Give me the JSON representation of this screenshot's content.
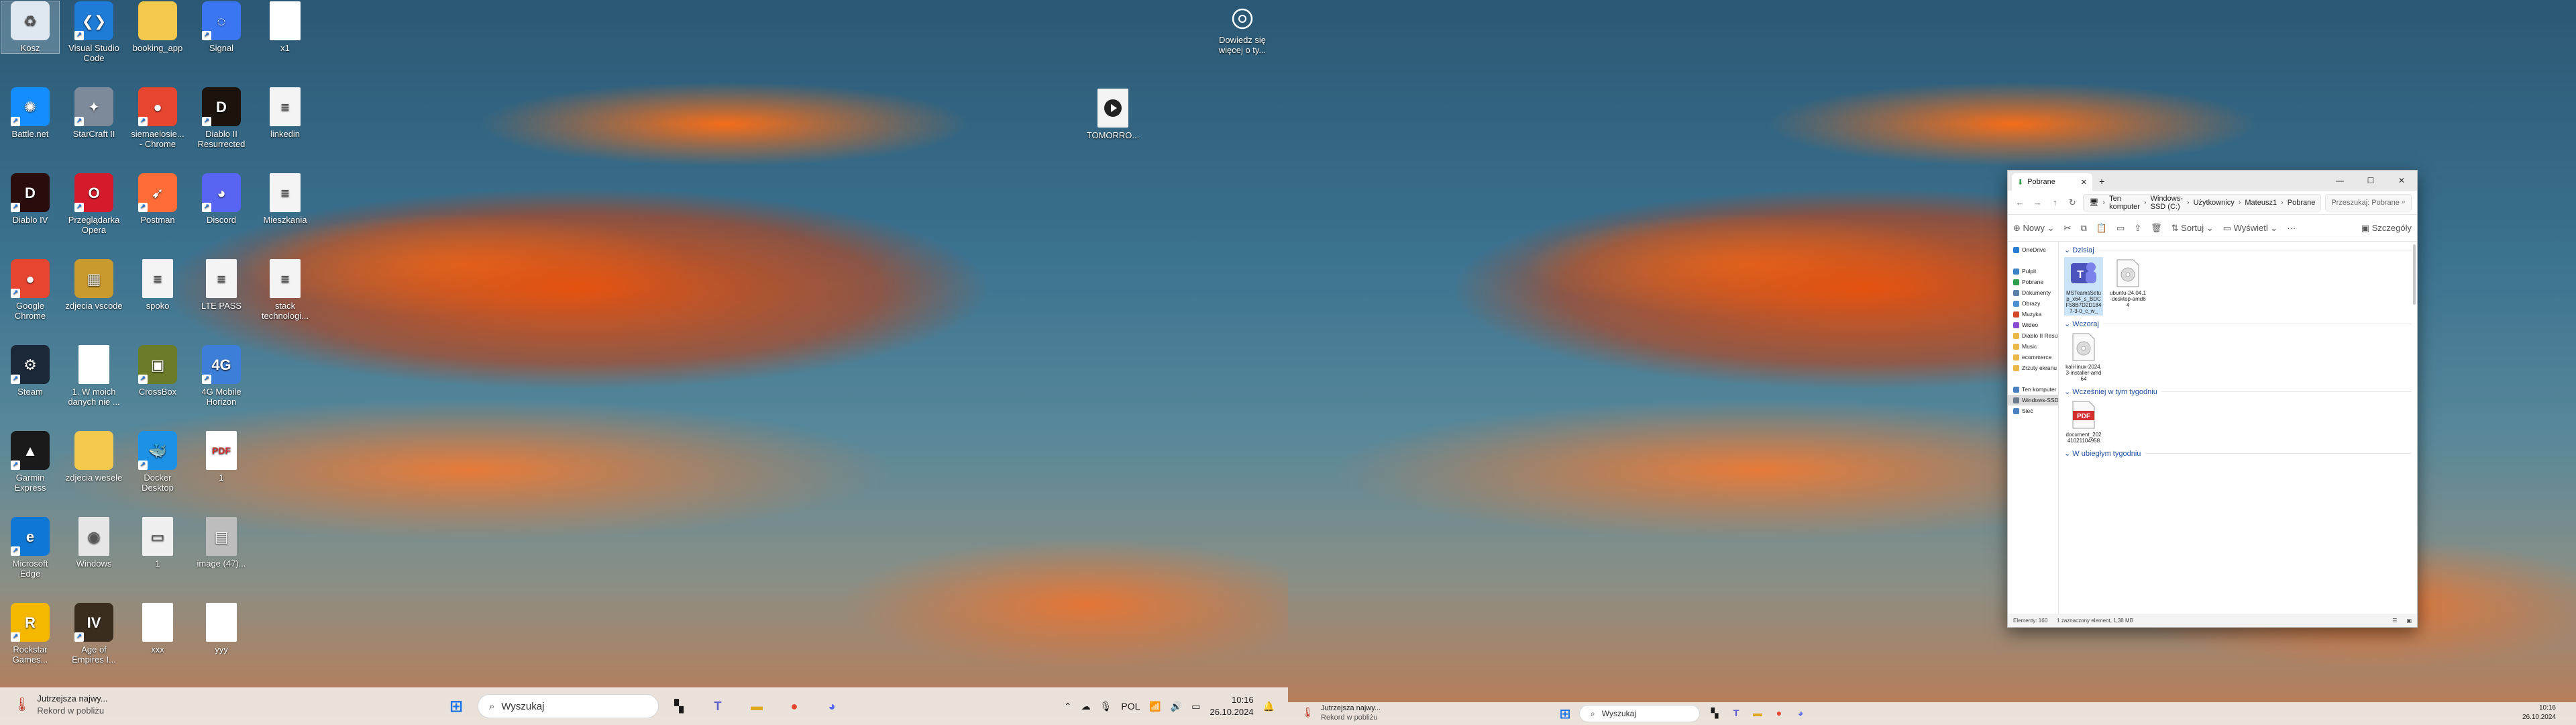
{
  "desktop_icons": [
    {
      "label": "Kosz",
      "icon": "recycle-bin-icon",
      "color": "#dfe8f0",
      "glyph": "♻"
    },
    {
      "label": "Visual Studio Code",
      "icon": "vscode-icon",
      "color": "#1e7bd6",
      "glyph": "❮❯"
    },
    {
      "label": "booking_app",
      "icon": "folder-icon",
      "color": "#f2c94c",
      "glyph": ""
    },
    {
      "label": "Signal",
      "icon": "signal-icon",
      "color": "#3a76f0",
      "glyph": "◌"
    },
    {
      "label": "x1",
      "icon": "document-icon",
      "color": "#ffffff",
      "glyph": ""
    },
    {
      "label": "Battle.net",
      "icon": "battlenet-icon",
      "color": "#148eff",
      "glyph": "✺"
    },
    {
      "label": "StarCraft II",
      "icon": "starcraft-icon",
      "color": "#7d8a99",
      "glyph": "✦"
    },
    {
      "label": "siemaelosie... - Chrome",
      "icon": "chrome-icon",
      "color": "#e6452f",
      "glyph": "●"
    },
    {
      "label": "Diablo II Resurrected",
      "icon": "diablo2-icon",
      "color": "#1a120b",
      "glyph": "D"
    },
    {
      "label": "linkedin",
      "icon": "document-icon",
      "color": "#f4f4f4",
      "glyph": "≡"
    },
    {
      "label": "Diablo IV",
      "icon": "diablo4-icon",
      "color": "#2a0c0c",
      "glyph": "D"
    },
    {
      "label": "Przeglądarka Opera",
      "icon": "opera-icon",
      "color": "#d51a2b",
      "glyph": "O"
    },
    {
      "label": "Postman",
      "icon": "postman-icon",
      "color": "#ff6c37",
      "glyph": "➹"
    },
    {
      "label": "Discord",
      "icon": "discord-icon",
      "color": "#5865f2",
      "glyph": "◕"
    },
    {
      "label": "Mieszkania",
      "icon": "document-icon",
      "color": "#f4f4f4",
      "glyph": "≡"
    },
    {
      "label": "Google Chrome",
      "icon": "chrome-icon",
      "color": "#e6452f",
      "glyph": "●"
    },
    {
      "label": "zdjecia vscode",
      "icon": "folder-image-icon",
      "color": "#c99a2e",
      "glyph": "▦"
    },
    {
      "label": "spoko",
      "icon": "document-icon",
      "color": "#f4f4f4",
      "glyph": "≡"
    },
    {
      "label": "LTE PASS",
      "icon": "document-icon",
      "color": "#f4f4f4",
      "glyph": "≡"
    },
    {
      "label": "stack technologi...",
      "icon": "document-icon",
      "color": "#f4f4f4",
      "glyph": "≡"
    },
    {
      "label": "Steam",
      "icon": "steam-icon",
      "color": "#1b2838",
      "glyph": "⚙"
    },
    {
      "label": "1. W moich danych nie ...",
      "icon": "document-icon",
      "color": "#ffffff",
      "glyph": ""
    },
    {
      "label": "CrossBox",
      "icon": "crossbox-icon",
      "color": "#6a7c2a",
      "glyph": "▣"
    },
    {
      "label": "4G Mobile Horizon",
      "icon": "mobile-horizon-icon",
      "color": "#3d7fd8",
      "glyph": "4G"
    },
    {
      "label": "",
      "icon": "empty-icon",
      "color": "transparent",
      "glyph": ""
    },
    {
      "label": "Garmin Express",
      "icon": "garmin-icon",
      "color": "#1a1a1a",
      "glyph": "▲"
    },
    {
      "label": "zdjecia wesele",
      "icon": "folder-icon",
      "color": "#f2c94c",
      "glyph": ""
    },
    {
      "label": "Docker Desktop",
      "icon": "docker-icon",
      "color": "#1d91e6",
      "glyph": "🐳"
    },
    {
      "label": "1",
      "icon": "pdf-icon",
      "color": "#ffffff",
      "glyph": "PDF"
    },
    {
      "label": "",
      "icon": "empty-icon",
      "color": "transparent",
      "glyph": ""
    },
    {
      "label": "Microsoft Edge",
      "icon": "edge-icon",
      "color": "#0f78d4",
      "glyph": "e"
    },
    {
      "label": "Windows",
      "icon": "iso-icon",
      "color": "#e6e6e6",
      "glyph": "◉"
    },
    {
      "label": "1",
      "icon": "image-icon",
      "color": "#f0f0f0",
      "glyph": "▭"
    },
    {
      "label": "image (47)...",
      "icon": "image-icon",
      "color": "#bdbdbd",
      "glyph": "▤"
    },
    {
      "label": "",
      "icon": "empty-icon",
      "color": "transparent",
      "glyph": ""
    },
    {
      "label": "Rockstar Games...",
      "icon": "rockstar-icon",
      "color": "#f5b700",
      "glyph": "R"
    },
    {
      "label": "Age of Empires I...",
      "icon": "aoe-icon",
      "color": "#3a2d1f",
      "glyph": "IV"
    },
    {
      "label": "xxx",
      "icon": "document-icon",
      "color": "#ffffff",
      "glyph": ""
    },
    {
      "label": "yyy",
      "icon": "document-icon",
      "color": "#ffffff",
      "glyph": ""
    },
    {
      "label": "",
      "icon": "empty-icon",
      "color": "transparent",
      "glyph": ""
    }
  ],
  "right_top_widget": {
    "label": "Dowiedz się więcej o ty..."
  },
  "tomorrow_icon": {
    "label": "TOMORRO..."
  },
  "taskbar_left": {
    "news_title": "Jutrzejsza najwy...",
    "news_sub": "Rekord w pobliżu",
    "search_placeholder": "Wyszukaj",
    "lang": "POL",
    "time": "10:16",
    "date": "26.10.2024"
  },
  "taskbar_right": {
    "news_title": "Jutrzejsza najwy...",
    "news_sub": "Rekord w pobliżu",
    "search_placeholder": "Wyszukaj",
    "time": "10:16",
    "date": "26.10.2024"
  },
  "explorer": {
    "tab_title": "Pobrane",
    "breadcrumbs": [
      "Ten komputer",
      "Windows-SSD (C:)",
      "Użytkownicy",
      "Mateusz1",
      "Pobrane"
    ],
    "search_placeholder": "Przeszukaj: Pobrane",
    "cmd": {
      "new": "Nowy",
      "sort": "Sortuj",
      "view": "Wyświetl",
      "details": "Szczegóły"
    },
    "nav": [
      {
        "label": "OneDrive",
        "color": "#2b7cd3"
      },
      {
        "label": "",
        "color": "transparent"
      },
      {
        "label": "Pulpit",
        "color": "#3b82c4"
      },
      {
        "label": "Pobrane",
        "color": "#2d9f4a"
      },
      {
        "label": "Dokumenty",
        "color": "#5a7fa8"
      },
      {
        "label": "Obrazy",
        "color": "#4b8fd1"
      },
      {
        "label": "Muzyka",
        "color": "#d2492a"
      },
      {
        "label": "Wideo",
        "color": "#8a4bd1"
      },
      {
        "label": "Diablo II Resurre",
        "color": "#e8b84a"
      },
      {
        "label": "Music",
        "color": "#e8b84a"
      },
      {
        "label": "ecommerce",
        "color": "#e8b84a"
      },
      {
        "label": "Zrzuty ekranu",
        "color": "#e8b84a"
      },
      {
        "label": "",
        "color": "transparent"
      },
      {
        "label": "Ten komputer",
        "color": "#4a7fc0"
      },
      {
        "label": "Windows-SSD",
        "color": "#6b7b8b"
      },
      {
        "label": "Sieć",
        "color": "#4a7fc0"
      }
    ],
    "groups": [
      {
        "title": "Dzisiaj",
        "files": [
          {
            "name": "MSTeamsSetup_x64_s_BDCF58B7D2D1847-3-0_c_w_",
            "type": "teams-installer-icon",
            "selected": true
          },
          {
            "name": "ubuntu-24.04.1-desktop-amd64",
            "type": "disc-image-icon",
            "selected": false
          }
        ]
      },
      {
        "title": "Wczoraj",
        "files": [
          {
            "name": "kali-linux-2024.3-installer-amd64",
            "type": "disc-image-icon",
            "selected": false
          }
        ]
      },
      {
        "title": "Wcześniej w tym tygodniu",
        "files": [
          {
            "name": "document_20241021104958",
            "type": "pdf-icon",
            "selected": false
          }
        ]
      },
      {
        "title": "W ubiegłym tygodniu",
        "files": []
      }
    ],
    "status": {
      "count": "Elementy: 160",
      "selected": "1 zaznaczony element, 1,38 MB"
    }
  }
}
